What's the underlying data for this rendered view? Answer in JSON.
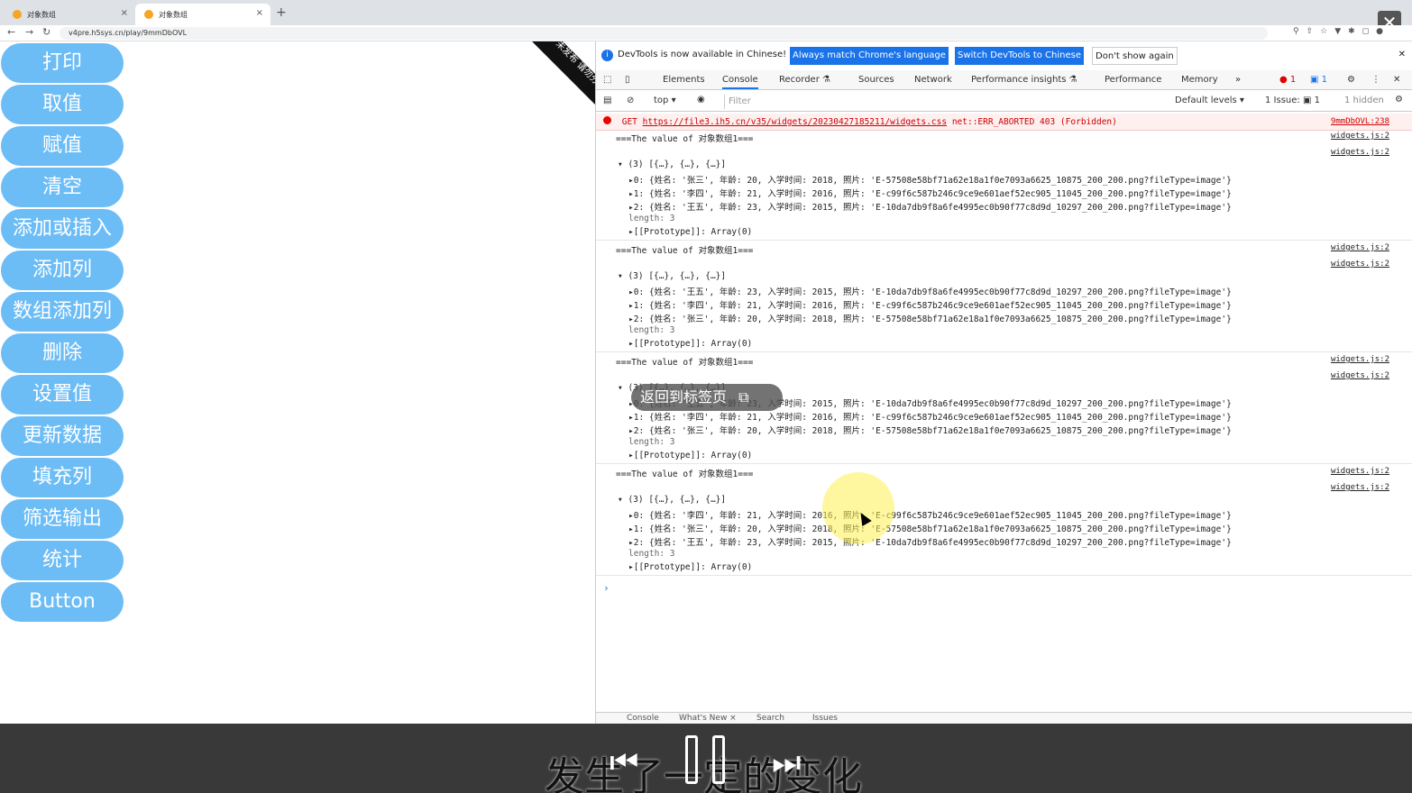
{
  "browser": {
    "tabs": [
      {
        "label": "对象数组"
      },
      {
        "label": "对象数组"
      }
    ],
    "url": "v4pre.h5sys.cn/play/9mmDbOVL"
  },
  "page": {
    "buttons": [
      "打印",
      "取值",
      "赋值",
      "清空",
      "添加或插入",
      "添加列",
      "数组添加列",
      "删除",
      "设置值",
      "更新数据",
      "填充列",
      "筛选输出",
      "统计",
      "Button"
    ],
    "ribbon_text": "未发布 请勿分享"
  },
  "devtools": {
    "info": {
      "text": "DevTools is now available in Chinese!",
      "btn_match": "Always match Chrome's language",
      "btn_switch": "Switch DevTools to Chinese",
      "btn_dismiss": "Don't show again"
    },
    "tabs": [
      "Elements",
      "Console",
      "Recorder ⚗",
      "Sources",
      "Network",
      "Performance insights ⚗",
      "Performance",
      "Memory",
      "»"
    ],
    "error_count": "1",
    "msg_count": "1",
    "toolbar": {
      "context": "top ▾",
      "filter_placeholder": "Filter",
      "levels": "Default levels ▾",
      "issues": "1 Issue: ▣ 1",
      "hidden": "1 hidden"
    },
    "error": {
      "method": "GET",
      "url": "https://file3.ih5.cn/v35/widgets/20230427185211/widgets.css",
      "msg": "net::ERR_ABORTED 403 (Forbidden)",
      "source": "9mmDbOVL:238"
    },
    "groups": [
      {
        "header": "===The value of 对象数组1===",
        "summary": "(3) [{…}, {…}, {…}]",
        "rows": [
          "▸0: {姓名: '张三', 年龄: 20, 入学时间: 2018, 照片: 'E-57508e58bf71a62e18a1f0e7093a6625_10875_200_200.png?fileType=image'}",
          "▸1: {姓名: '李四', 年龄: 21, 入学时间: 2016, 照片: 'E-c99f6c587b246c9ce9e601aef52ec905_11045_200_200.png?fileType=image'}",
          "▸2: {姓名: '王五', 年龄: 23, 入学时间: 2015, 照片: 'E-10da7db9f8a6fe4995ec0b90f77c8d9d_10297_200_200.png?fileType=image'}"
        ]
      },
      {
        "header": "===The value of 对象数组1===",
        "summary": "(3) [{…}, {…}, {…}]",
        "rows": [
          "▸0: {姓名: '王五', 年龄: 23, 入学时间: 2015, 照片: 'E-10da7db9f8a6fe4995ec0b90f77c8d9d_10297_200_200.png?fileType=image'}",
          "▸1: {姓名: '李四', 年龄: 21, 入学时间: 2016, 照片: 'E-c99f6c587b246c9ce9e601aef52ec905_11045_200_200.png?fileType=image'}",
          "▸2: {姓名: '张三', 年龄: 20, 入学时间: 2018, 照片: 'E-57508e58bf71a62e18a1f0e7093a6625_10875_200_200.png?fileType=image'}"
        ]
      },
      {
        "header": "===The value of 对象数组1===",
        "summary": "(3) [{…}, {…}, {…}]",
        "rows": [
          "▸0: {姓名: '王五', 年龄: 23, 入学时间: 2015, 照片: 'E-10da7db9f8a6fe4995ec0b90f77c8d9d_10297_200_200.png?fileType=image'}",
          "▸1: {姓名: '李四', 年龄: 21, 入学时间: 2016, 照片: 'E-c99f6c587b246c9ce9e601aef52ec905_11045_200_200.png?fileType=image'}",
          "▸2: {姓名: '张三', 年龄: 20, 入学时间: 2018, 照片: 'E-57508e58bf71a62e18a1f0e7093a6625_10875_200_200.png?fileType=image'}"
        ]
      },
      {
        "header": "===The value of 对象数组1===",
        "summary": "(3) [{…}, {…}, {…}]",
        "rows": [
          "▸0: {姓名: '李四', 年龄: 21, 入学时间: 2016, 照片: 'E-c99f6c587b246c9ce9e601aef52ec905_11045_200_200.png?fileType=image'}",
          "▸1: {姓名: '张三', 年龄: 20, 入学时间: 2018, 照片: 'E-57508e58bf71a62e18a1f0e7093a6625_10875_200_200.png?fileType=image'}",
          "▸2: {姓名: '王五', 年龄: 23, 入学时间: 2015, 照片: 'E-10da7db9f8a6fe4995ec0b90f77c8d9d_10297_200_200.png?fileType=image'}"
        ]
      }
    ],
    "length_line": "length: 3",
    "proto_line": "▸[[Prototype]]: Array(0)",
    "source_link": "widgets.js:2",
    "drawer_tabs": [
      "Console",
      "What's New ×",
      "Search",
      "Issues"
    ]
  },
  "overlay": {
    "back_pill": "返回到标签页",
    "subtitle": "发生了一定的变化"
  }
}
